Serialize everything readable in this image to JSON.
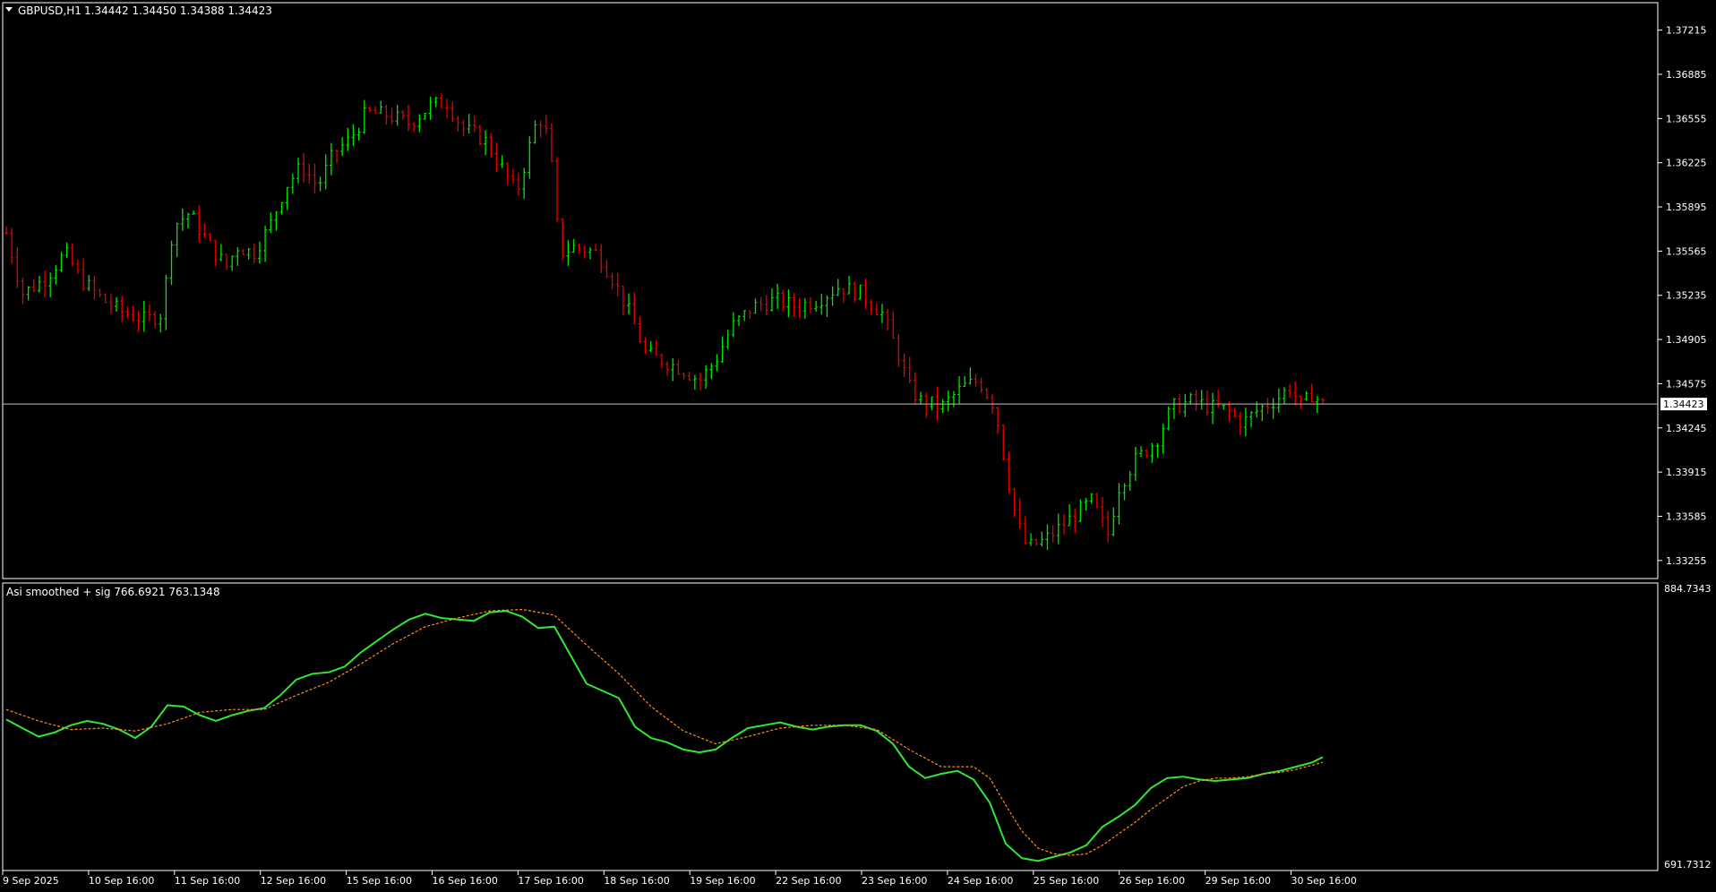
{
  "chart_data": [
    {
      "type": "candlestick",
      "title": "GBPUSD,H1",
      "ohlc_header": "1.34442 1.34450 1.34388 1.34423",
      "header_collapse_icon": "triangle-down-icon",
      "last_price": 1.34423,
      "last_price_label": "1.34423",
      "ylim": [
        1.3312,
        1.3742
      ],
      "y_ticks": [
        "1.37215",
        "1.36885",
        "1.36555",
        "1.36225",
        "1.35895",
        "1.35565",
        "1.35235",
        "1.34905",
        "1.34575",
        "1.34245",
        "1.33915",
        "1.33585",
        "1.33255"
      ],
      "bar_count": 240,
      "colors": {
        "up": "#00e600",
        "down": "#e60000",
        "axis": "#ffffff",
        "price_line": "#c0c0c0"
      },
      "close_path": [
        [
          0,
          1.357
        ],
        [
          6,
          1.3525
        ],
        [
          14,
          1.3535
        ],
        [
          22,
          1.3555
        ],
        [
          28,
          1.3535
        ],
        [
          36,
          1.352
        ],
        [
          44,
          1.351
        ],
        [
          52,
          1.3505
        ],
        [
          58,
          1.351
        ],
        [
          62,
          1.3575
        ],
        [
          68,
          1.3585
        ],
        [
          76,
          1.356
        ],
        [
          82,
          1.3545
        ],
        [
          86,
          1.356
        ],
        [
          92,
          1.3555
        ],
        [
          98,
          1.3575
        ],
        [
          104,
          1.3605
        ],
        [
          110,
          1.362
        ],
        [
          116,
          1.3605
        ],
        [
          122,
          1.363
        ],
        [
          128,
          1.364
        ],
        [
          134,
          1.366
        ],
        [
          142,
          1.3658
        ],
        [
          150,
          1.3652
        ],
        [
          158,
          1.3665
        ],
        [
          164,
          1.3668
        ],
        [
          170,
          1.3648
        ],
        [
          178,
          1.364
        ],
        [
          184,
          1.362
        ],
        [
          190,
          1.36
        ],
        [
          198,
          1.3658
        ],
        [
          202,
          1.364
        ],
        [
          206,
          1.3555
        ],
        [
          212,
          1.356
        ],
        [
          220,
          1.3555
        ],
        [
          226,
          1.3535
        ],
        [
          232,
          1.351
        ],
        [
          238,
          1.348
        ],
        [
          244,
          1.3475
        ],
        [
          252,
          1.3468
        ],
        [
          258,
          1.346
        ],
        [
          264,
          1.3475
        ],
        [
          270,
          1.35
        ],
        [
          278,
          1.3515
        ],
        [
          286,
          1.352
        ],
        [
          294,
          1.3515
        ],
        [
          302,
          1.352
        ],
        [
          310,
          1.353
        ],
        [
          318,
          1.3525
        ],
        [
          326,
          1.351
        ],
        [
          332,
          1.348
        ],
        [
          336,
          1.3455
        ],
        [
          340,
          1.3445
        ],
        [
          348,
          1.344
        ],
        [
          356,
          1.3455
        ],
        [
          362,
          1.346
        ],
        [
          368,
          1.344
        ],
        [
          372,
          1.3395
        ],
        [
          376,
          1.3355
        ],
        [
          380,
          1.3335
        ],
        [
          386,
          1.334
        ],
        [
          392,
          1.335
        ],
        [
          398,
          1.336
        ],
        [
          404,
          1.337
        ],
        [
          410,
          1.3345
        ],
        [
          414,
          1.338
        ],
        [
          420,
          1.34
        ],
        [
          428,
          1.3415
        ],
        [
          434,
          1.344
        ],
        [
          442,
          1.3445
        ],
        [
          448,
          1.344
        ],
        [
          454,
          1.3438
        ],
        [
          460,
          1.3428
        ],
        [
          466,
          1.3438
        ],
        [
          472,
          1.3445
        ],
        [
          478,
          1.3455
        ],
        [
          482,
          1.344
        ],
        [
          486,
          1.345
        ],
        [
          490,
          1.3442
        ]
      ]
    },
    {
      "type": "line",
      "title": "Asi smoothed + sig 766.6921 763.1348",
      "ylim": [
        691.7312,
        884.7343
      ],
      "y_ticks": [
        "884.7343",
        "691.7312"
      ],
      "series": [
        {
          "color": "#32e632",
          "style": "solid",
          "values": [
            [
              0,
              793
            ],
            [
              6,
              787
            ],
            [
              12,
              781
            ],
            [
              18,
              784
            ],
            [
              24,
              789
            ],
            [
              30,
              792
            ],
            [
              36,
              790
            ],
            [
              42,
              786
            ],
            [
              48,
              780
            ],
            [
              54,
              788
            ],
            [
              60,
              803
            ],
            [
              66,
              802
            ],
            [
              72,
              796
            ],
            [
              78,
              792
            ],
            [
              84,
              796
            ],
            [
              90,
              799
            ],
            [
              96,
              801
            ],
            [
              102,
              810
            ],
            [
              108,
              821
            ],
            [
              114,
              825
            ],
            [
              120,
              826
            ],
            [
              126,
              830
            ],
            [
              132,
              840
            ],
            [
              138,
              848
            ],
            [
              144,
              856
            ],
            [
              150,
              863
            ],
            [
              156,
              867
            ],
            [
              162,
              864
            ],
            [
              168,
              863
            ],
            [
              174,
              862
            ],
            [
              180,
              868
            ],
            [
              186,
              869
            ],
            [
              192,
              865
            ],
            [
              198,
              857
            ],
            [
              204,
              858
            ],
            [
              210,
              838
            ],
            [
              216,
              818
            ],
            [
              222,
              813
            ],
            [
              228,
              808
            ],
            [
              234,
              788
            ],
            [
              240,
              780
            ],
            [
              246,
              777
            ],
            [
              252,
              772
            ],
            [
              258,
              770
            ],
            [
              264,
              772
            ],
            [
              270,
              780
            ],
            [
              276,
              787
            ],
            [
              282,
              789
            ],
            [
              288,
              791
            ],
            [
              294,
              788
            ],
            [
              300,
              786
            ],
            [
              306,
              788
            ],
            [
              312,
              789
            ],
            [
              318,
              789
            ],
            [
              324,
              785
            ],
            [
              330,
              776
            ],
            [
              336,
              760
            ],
            [
              342,
              752
            ],
            [
              348,
              755
            ],
            [
              354,
              757
            ],
            [
              360,
              751
            ],
            [
              366,
              735
            ],
            [
              372,
              706
            ],
            [
              378,
              696
            ],
            [
              384,
              694
            ],
            [
              390,
              697
            ],
            [
              396,
              700
            ],
            [
              402,
              705
            ],
            [
              408,
              718
            ],
            [
              414,
              725
            ],
            [
              420,
              733
            ],
            [
              426,
              745
            ],
            [
              432,
              752
            ],
            [
              438,
              753
            ],
            [
              444,
              751
            ],
            [
              450,
              750
            ],
            [
              456,
              751
            ],
            [
              462,
              752
            ],
            [
              468,
              755
            ],
            [
              474,
              757
            ],
            [
              480,
              760
            ],
            [
              486,
              763
            ],
            [
              490,
              766.69
            ]
          ]
        },
        {
          "color": "#ff8c1a",
          "style": "dashed",
          "values": [
            [
              0,
              800
            ],
            [
              12,
              792
            ],
            [
              24,
              786
            ],
            [
              36,
              787
            ],
            [
              48,
              785
            ],
            [
              60,
              790
            ],
            [
              72,
              798
            ],
            [
              84,
              800
            ],
            [
              96,
              800
            ],
            [
              108,
              810
            ],
            [
              120,
              819
            ],
            [
              132,
              832
            ],
            [
              144,
              846
            ],
            [
              156,
              858
            ],
            [
              168,
              864
            ],
            [
              180,
              869
            ],
            [
              192,
              870
            ],
            [
              204,
              866
            ],
            [
              216,
              845
            ],
            [
              228,
              825
            ],
            [
              240,
              802
            ],
            [
              252,
              785
            ],
            [
              264,
              776
            ],
            [
              276,
              781
            ],
            [
              288,
              787
            ],
            [
              300,
              789
            ],
            [
              312,
              789
            ],
            [
              324,
              786
            ],
            [
              336,
              772
            ],
            [
              348,
              760
            ],
            [
              360,
              760
            ],
            [
              366,
              752
            ],
            [
              372,
              733
            ],
            [
              378,
              715
            ],
            [
              384,
              703
            ],
            [
              390,
              699
            ],
            [
              396,
              698
            ],
            [
              402,
              699
            ],
            [
              408,
              705
            ],
            [
              414,
              713
            ],
            [
              420,
              721
            ],
            [
              426,
              730
            ],
            [
              432,
              738
            ],
            [
              438,
              746
            ],
            [
              444,
              750
            ],
            [
              450,
              752
            ],
            [
              456,
              752
            ],
            [
              462,
              753
            ],
            [
              468,
              755
            ],
            [
              474,
              756
            ],
            [
              480,
              758
            ],
            [
              486,
              761
            ],
            [
              490,
              763.13
            ]
          ]
        }
      ]
    }
  ],
  "x_axis": {
    "labels": [
      "9 Sep 2025",
      "10 Sep 16:00",
      "11 Sep 16:00",
      "12 Sep 16:00",
      "15 Sep 16:00",
      "16 Sep 16:00",
      "17 Sep 16:00",
      "18 Sep 16:00",
      "19 Sep 16:00",
      "22 Sep 16:00",
      "23 Sep 16:00",
      "24 Sep 16:00",
      "25 Sep 16:00",
      "26 Sep 16:00",
      "29 Sep 16:00",
      "30 Sep 16:00"
    ]
  }
}
